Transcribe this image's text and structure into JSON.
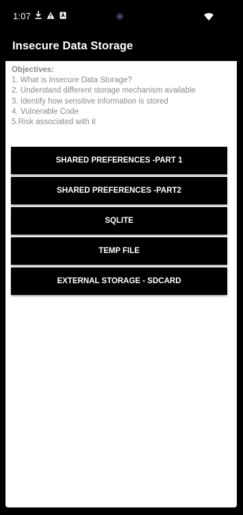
{
  "status_bar": {
    "time": "1:07",
    "icons": [
      "download-icon",
      "warning-icon",
      "app-notification-icon",
      "wifi-icon"
    ]
  },
  "app_bar": {
    "title": "Insecure Data Storage"
  },
  "objectives": {
    "heading": "Objectives:",
    "items": [
      " 1. What is Insecure Data Storage?",
      " 2. Understand different storage mechanism available",
      " 3. Identify how sensitive information is stored",
      " 4. Vulnerable Code",
      " 5.Risk associated with it"
    ]
  },
  "buttons": [
    "SHARED PREFERENCES -PART 1",
    "SHARED PREFERENCES -PART2",
    "SQLITE",
    "TEMP FILE",
    "EXTERNAL STORAGE - SDCARD"
  ]
}
